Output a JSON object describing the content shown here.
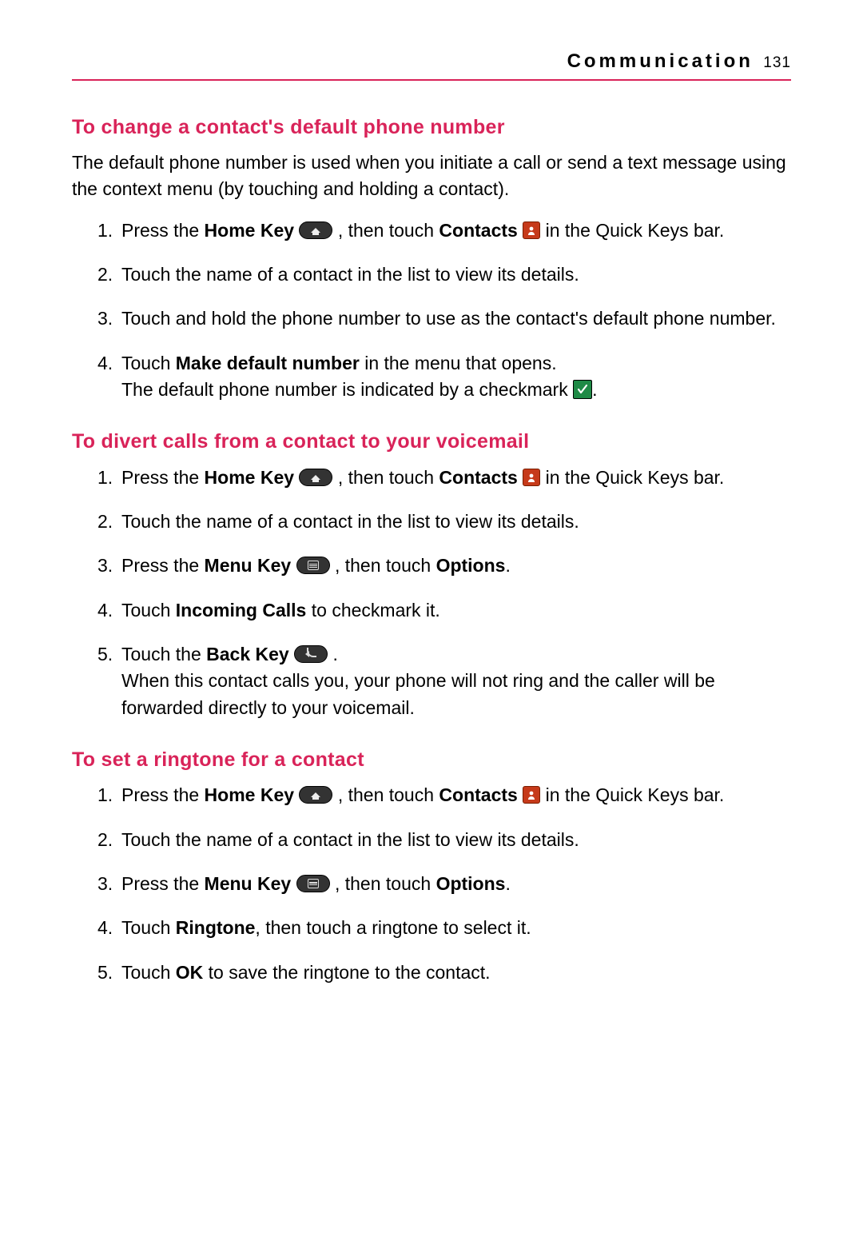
{
  "header": {
    "title": "Communication",
    "page": "131"
  },
  "s1": {
    "heading": "To change a contact's default phone number",
    "intro": "The default phone number is used when you initiate a call or send a text message using the context menu (by touching and holding a contact).",
    "step1_a": "Press the ",
    "home_key": "Home Key",
    "step1_b": ", then touch ",
    "contacts": "Contacts",
    "step1_c": " in the Quick Keys bar.",
    "step2": "Touch the name of a contact in the list to view its details.",
    "step3": "Touch and hold the phone number to use as the contact's default phone number.",
    "step4_a": "Touch ",
    "make_default": "Make default number",
    "step4_b": " in the menu that opens.",
    "step4_c": "The default phone number is indicated by a checkmark ",
    "step4_d": "."
  },
  "s2": {
    "heading": "To divert calls from a contact to your voicemail",
    "step1_a": "Press the ",
    "home_key": "Home Key",
    "step1_b": ", then touch ",
    "contacts": "Contacts",
    "step1_c": " in the Quick Keys bar.",
    "step2": "Touch the name of a contact in the list to view its details.",
    "step3_a": "Press the ",
    "menu_key": "Menu Key",
    "step3_b": " , then touch ",
    "options": "Options",
    "step3_c": ".",
    "step4_a": "Touch ",
    "incoming": "Incoming Calls",
    "step4_b": " to checkmark it.",
    "step5_a": "Touch the ",
    "back_key": "Back Key",
    "step5_b": " .",
    "step5_c": "When this contact calls you, your phone will not ring and the caller will be forwarded directly to your voicemail."
  },
  "s3": {
    "heading": "To set a ringtone for a contact",
    "step1_a": "Press the ",
    "home_key": "Home Key",
    "step1_b": ", then touch ",
    "contacts": "Contacts",
    "step1_c": " in the Quick Keys bar.",
    "step2": "Touch the name of a contact in the list to view its details.",
    "step3_a": "Press the ",
    "menu_key": "Menu Key",
    "step3_b": " , then touch ",
    "options": "Options",
    "step3_c": ".",
    "step4_a": "Touch ",
    "ringtone": "Ringtone",
    "step4_b": ", then touch a ringtone to select it.",
    "step5_a": "Touch ",
    "ok": "OK",
    "step5_b": " to save the ringtone to the contact."
  }
}
